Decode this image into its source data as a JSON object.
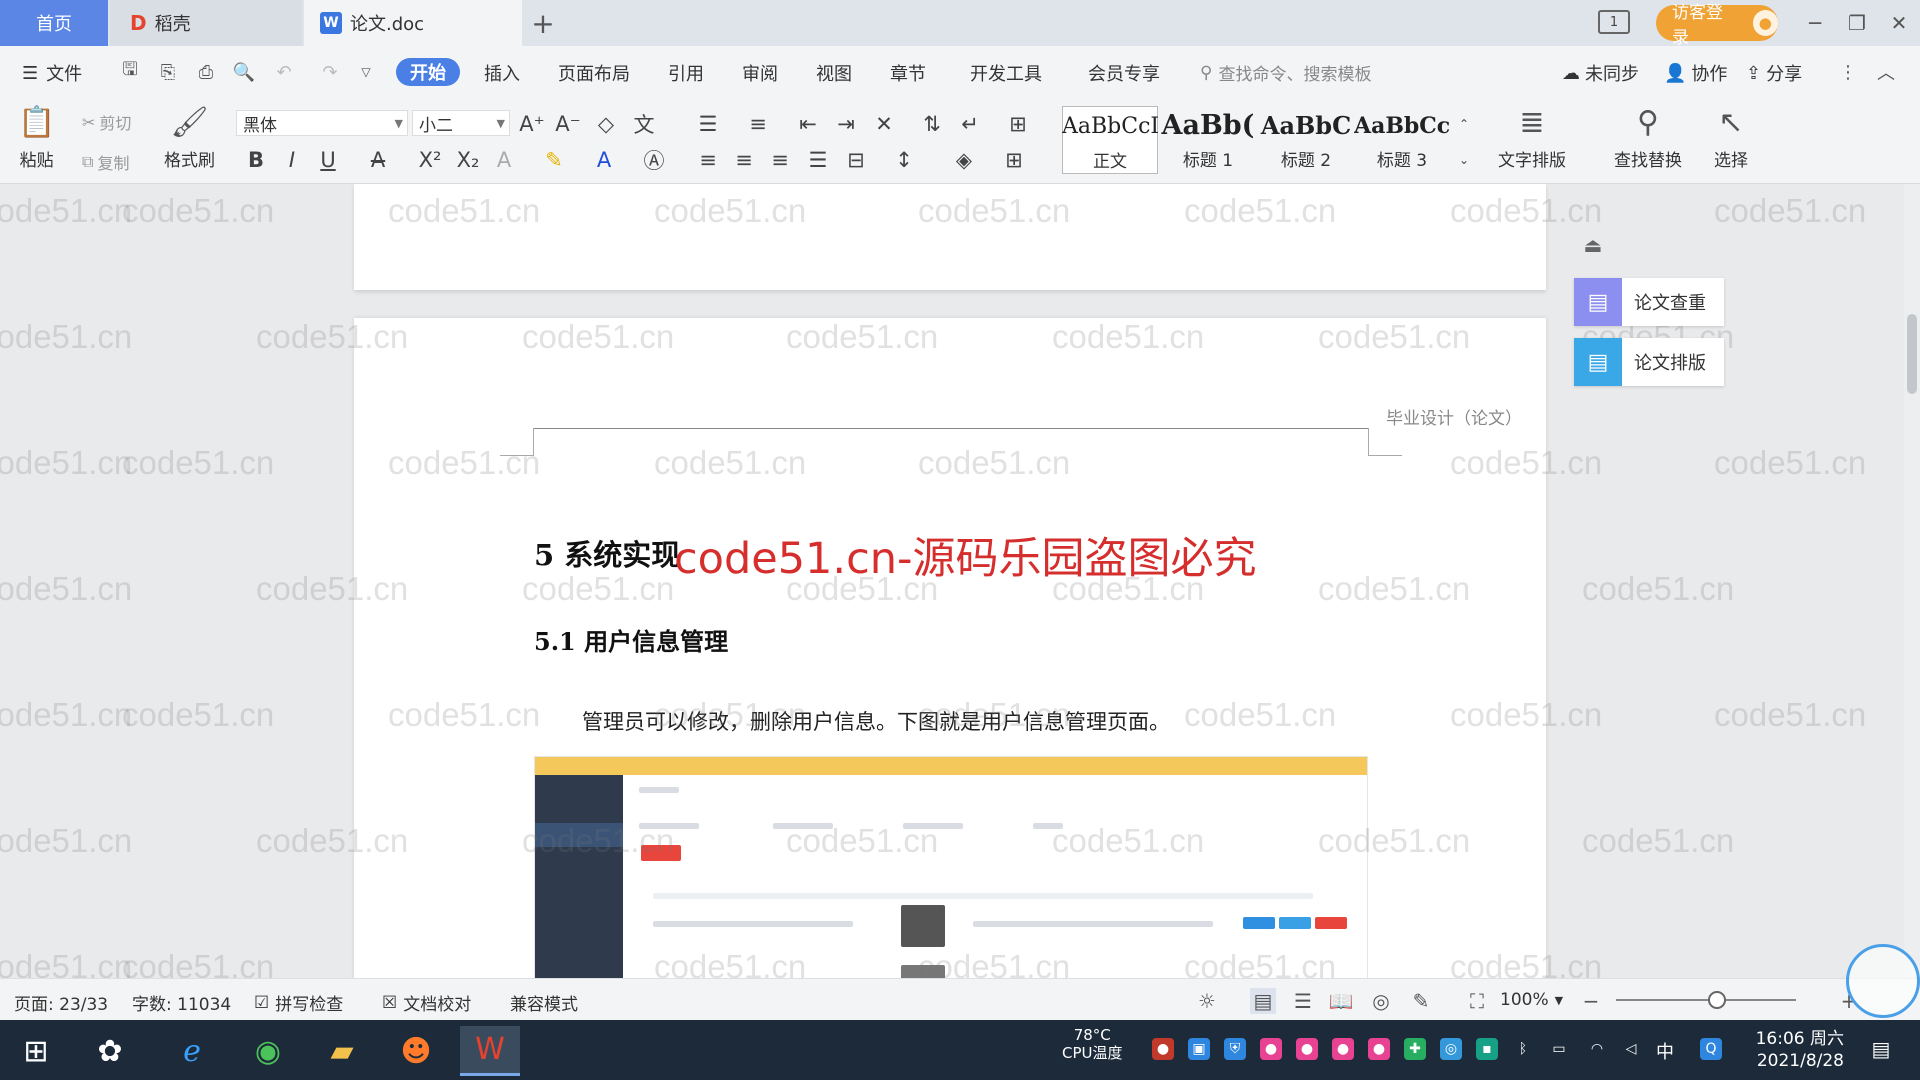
{
  "tabs": {
    "home": "首页",
    "docer": "稻壳",
    "doc": "论文.doc",
    "add": "+"
  },
  "titlebar": {
    "login": "访客登录",
    "layout_icon": "1"
  },
  "menu": {
    "file": "文件",
    "items": [
      "开始",
      "插入",
      "页面布局",
      "引用",
      "审阅",
      "视图",
      "章节",
      "开发工具",
      "会员专享"
    ],
    "search_placeholder": "查找命令、搜索模板",
    "unsync": "未同步",
    "collab": "协作",
    "share": "分享"
  },
  "ribbon": {
    "paste": "粘贴",
    "cut": "剪切",
    "copy": "复制",
    "format_painter": "格式刷",
    "font_name": "黑体",
    "font_size": "小二",
    "styles": [
      {
        "sample": "AaBbCcI",
        "label": "正文"
      },
      {
        "sample": "AaBb(",
        "label": "标题 1"
      },
      {
        "sample": "AaBbC",
        "label": "标题 2"
      },
      {
        "sample": "AaBbCcl",
        "label": "标题 3"
      }
    ],
    "text_layout": "文字排版",
    "find_replace": "查找替换",
    "select": "选择"
  },
  "document": {
    "header_text": "毕业设计（论文）",
    "heading1": "5  系统实现",
    "heading2": "5.1  用户信息管理",
    "paragraph": "管理员可以修改，删除用户信息。下图就是用户信息管理页面。",
    "banner": "code51.cn-源码乐园盗图必究",
    "watermark": "code51.cn"
  },
  "side_panel": {
    "check": "论文查重",
    "format": "论文排版"
  },
  "status": {
    "page": "页面: 23/33",
    "words": "字数: 11034",
    "spellcheck": "拼写检查",
    "proofread": "文档校对",
    "compat": "兼容模式",
    "zoom": "100%"
  },
  "taskbar": {
    "temp": "78°C",
    "temp_label": "CPU温度",
    "ime": "中",
    "time": "16:06 周六",
    "date": "2021/8/28"
  }
}
